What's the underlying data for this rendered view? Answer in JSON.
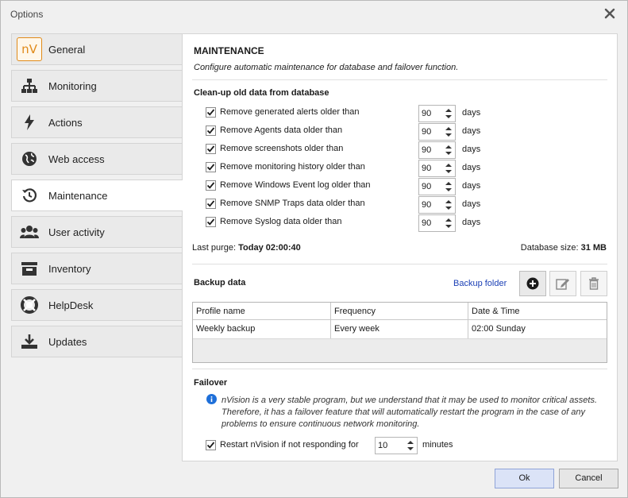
{
  "window": {
    "title": "Options"
  },
  "sidebar": {
    "items": [
      {
        "label": "General",
        "icon": "nv-logo-icon"
      },
      {
        "label": "Monitoring",
        "icon": "network-icon"
      },
      {
        "label": "Actions",
        "icon": "lightning-icon"
      },
      {
        "label": "Web access",
        "icon": "globe-icon"
      },
      {
        "label": "Maintenance",
        "icon": "history-icon",
        "active": true
      },
      {
        "label": "User activity",
        "icon": "users-icon"
      },
      {
        "label": "Inventory",
        "icon": "inbox-icon"
      },
      {
        "label": "HelpDesk",
        "icon": "lifebuoy-icon"
      },
      {
        "label": "Updates",
        "icon": "download-icon"
      }
    ],
    "logo_text": "nV"
  },
  "main": {
    "title": "MAINTENANCE",
    "subtitle": "Configure automatic maintenance for database and failover function.",
    "cleanup": {
      "title": "Clean-up old data from database",
      "rows": [
        {
          "label": "Remove generated alerts older than",
          "value": "90",
          "unit": "days",
          "checked": true
        },
        {
          "label": "Remove Agents data older than",
          "value": "90",
          "unit": "days",
          "checked": true
        },
        {
          "label": "Remove screenshots older than",
          "value": "90",
          "unit": "days",
          "checked": true
        },
        {
          "label": "Remove monitoring history older than",
          "value": "90",
          "unit": "days",
          "checked": true
        },
        {
          "label": "Remove Windows Event log older than",
          "value": "90",
          "unit": "days",
          "checked": true
        },
        {
          "label": "Remove SNMP Traps data older than",
          "value": "90",
          "unit": "days",
          "checked": true
        },
        {
          "label": "Remove Syslog data older than",
          "value": "90",
          "unit": "days",
          "checked": true
        }
      ]
    },
    "last_purge_label": "Last purge:",
    "last_purge_value": "Today 02:00:40",
    "db_size_label": "Database size:",
    "db_size_value": "31 MB",
    "backup": {
      "title": "Backup data",
      "folder_link": "Backup folder",
      "columns": [
        "Profile name",
        "Frequency",
        "Date & Time"
      ],
      "rows": [
        [
          "Weekly backup",
          "Every week",
          "02:00 Sunday"
        ]
      ]
    },
    "failover": {
      "title": "Failover",
      "note": "nVision is a very stable program, but we understand that it may be used to monitor critical assets. Therefore, it has a failover feature that will automatically restart the program in the case of any problems to ensure continuous network monitoring.",
      "restart_label": "Restart nVision if not responding for",
      "restart_value": "10",
      "restart_unit": "minutes"
    }
  },
  "footer": {
    "ok": "Ok",
    "cancel": "Cancel"
  },
  "colors": {
    "accent": "#e08a1a",
    "link": "#1a3fb5"
  }
}
